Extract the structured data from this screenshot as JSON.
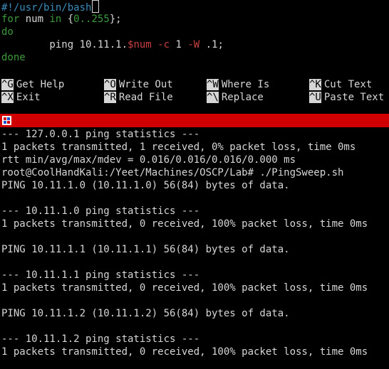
{
  "editor": {
    "lines": [
      {
        "parts": [
          {
            "t": "#!/usr/bin/bash",
            "c": "kw-comment"
          }
        ]
      },
      {
        "parts": [
          {
            "t": "for",
            "c": "kw"
          },
          {
            "t": " num ",
            "c": ""
          },
          {
            "t": "in",
            "c": "kw"
          },
          {
            "t": " {",
            "c": ""
          },
          {
            "t": "0..255",
            "c": "num"
          },
          {
            "t": "};",
            "c": ""
          }
        ]
      },
      {
        "parts": [
          {
            "t": "do",
            "c": "kw"
          }
        ]
      },
      {
        "parts": [
          {
            "t": "        ping 10.11.1.",
            "c": ""
          },
          {
            "t": "$num",
            "c": "var"
          },
          {
            "t": " ",
            "c": ""
          },
          {
            "t": "-c",
            "c": "opt"
          },
          {
            "t": " 1 ",
            "c": ""
          },
          {
            "t": "-W",
            "c": "opt"
          },
          {
            "t": " .1;",
            "c": ""
          }
        ]
      },
      {
        "parts": [
          {
            "t": "done",
            "c": "kw"
          }
        ]
      }
    ]
  },
  "shortcuts": [
    {
      "key": "^G",
      "label": "Get Help"
    },
    {
      "key": "^O",
      "label": "Write Out"
    },
    {
      "key": "^W",
      "label": "Where Is"
    },
    {
      "key": "^K",
      "label": "Cut Text"
    },
    {
      "key": "^X",
      "label": "Exit"
    },
    {
      "key": "^R",
      "label": "Read File"
    },
    {
      "key": "^\\",
      "label": "Replace"
    },
    {
      "key": "^U",
      "label": "Paste Text"
    }
  ],
  "divider": {
    "color": "#d00000",
    "icon": "tmux-pane-icon"
  },
  "terminal": {
    "lines": [
      "--- 127.0.0.1 ping statistics ---",
      "1 packets transmitted, 1 received, 0% packet loss, time 0ms",
      "rtt min/avg/max/mdev = 0.016/0.016/0.016/0.000 ms",
      "root@CoolHandKali:/Yeet/Machines/OSCP/Lab# ./PingSweep.sh",
      "PING 10.11.1.0 (10.11.1.0) 56(84) bytes of data.",
      "",
      "--- 10.11.1.0 ping statistics ---",
      "1 packets transmitted, 0 received, 100% packet loss, time 0ms",
      "",
      "PING 10.11.1.1 (10.11.1.1) 56(84) bytes of data.",
      "",
      "--- 10.11.1.1 ping statistics ---",
      "1 packets transmitted, 0 received, 100% packet loss, time 0ms",
      "",
      "PING 10.11.1.2 (10.11.1.2) 56(84) bytes of data.",
      "",
      "--- 10.11.1.2 ping statistics ---",
      "1 packets transmitted, 0 received, 100% packet loss, time 0ms"
    ]
  }
}
